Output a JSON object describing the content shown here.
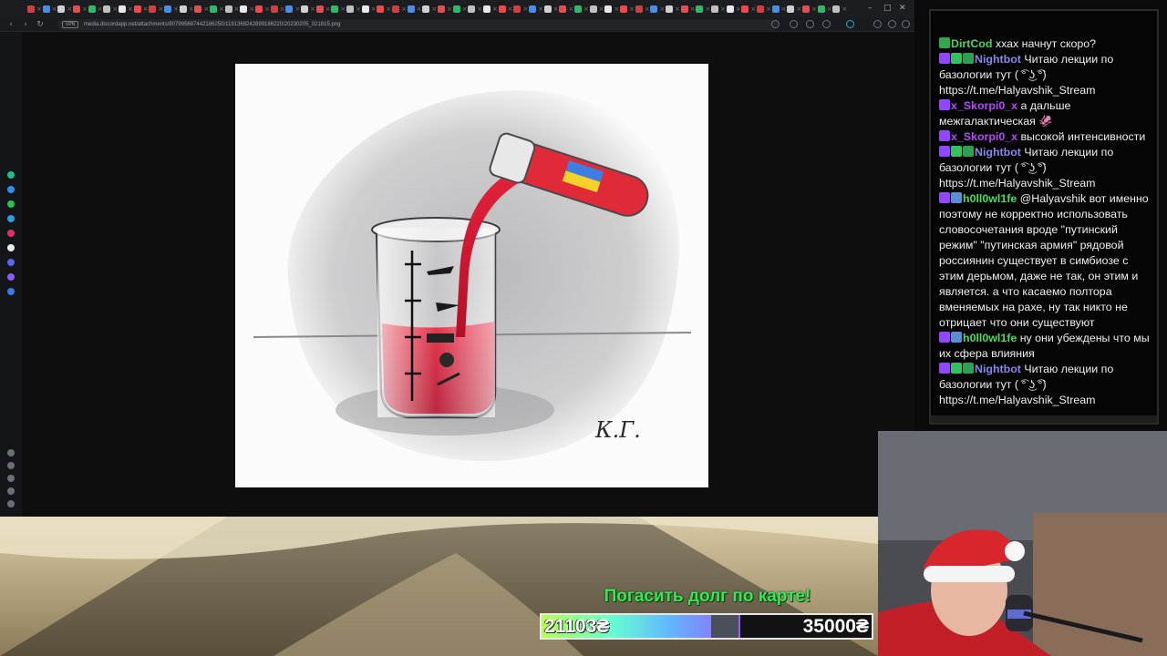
{
  "browser": {
    "tab_count": 54,
    "vpn_badge": "VPN",
    "url": "media.discordapp.net/attachments/807995687442186250/1191368242899186220/20230205_021815.png",
    "nav": {
      "back_icon": "back-arrow-icon",
      "forward_icon": "forward-arrow-icon",
      "reload_icon": "reload-icon"
    },
    "window_controls": [
      "–",
      "□",
      "✕"
    ]
  },
  "viewer": {
    "image_description_icon": "cartoon-image",
    "signature": "К.Г."
  },
  "chat": {
    "messages": [
      {
        "user": "DirtCod",
        "color": "#50d45a",
        "badges": [
          "green-k"
        ],
        "text": "ххах начнут скоро?"
      },
      {
        "user": "Nightbot",
        "color": "#8a86f0",
        "badges": [
          "purple",
          "green",
          "green-box"
        ],
        "text": "Читаю лекции по базологии тут ( ͡° ͜ʖ ͡°)  https://t.me/Halyavshik_Stream"
      },
      {
        "user": "x_Skorpi0_x",
        "color": "#b04cf2",
        "badges": [
          "purple"
        ],
        "text": "а дальше межгалактическая 🦑"
      },
      {
        "user": "x_Skorpi0_x",
        "color": "#b04cf2",
        "badges": [
          "purple"
        ],
        "text": "высокой интенсивности"
      },
      {
        "user": "Nightbot",
        "color": "#8a86f0",
        "badges": [
          "purple",
          "green",
          "green-box"
        ],
        "text": "Читаю лекции по базологии тут ( ͡° ͜ʖ ͡°)  https://t.me/Halyavshik_Stream"
      },
      {
        "user": "h0ll0wl1fe",
        "color": "#42e05a",
        "badges": [
          "purple",
          "blue-globe"
        ],
        "text": "@Halyavshik вот именно поэтому не корректно использовать словосочетания вроде \"путинский режим\" \"путинская армия\" рядовой россиянин существует в симбиозе с этим дерьмом, даже не так, он этим и является. а что касаемо полтора вменяемых на рахе, ну так никто не отрицает что они существуют"
      },
      {
        "user": "h0ll0wl1fe",
        "color": "#42e05a",
        "badges": [
          "purple",
          "blue-globe"
        ],
        "text": "ну они убеждены что мы их сфера влияния"
      },
      {
        "user": "Nightbot",
        "color": "#8a86f0",
        "badges": [
          "purple",
          "green",
          "green-box"
        ],
        "text": "Читаю лекции по базологии тут ( ͡° ͜ʖ ͡°)  https://t.me/Halyavshik_Stream"
      }
    ]
  },
  "goal": {
    "title": "Погасить долг по карте!",
    "current": "21103₴",
    "target": "35000₴",
    "progress_fraction": 0.603
  },
  "colors": {
    "chat_bg": "#050505",
    "goal_title": "#39e65a",
    "nightbot": "#8a86f0",
    "skorpio": "#b04cf2",
    "hollow": "#42e05a",
    "dirtcod": "#50d45a"
  }
}
